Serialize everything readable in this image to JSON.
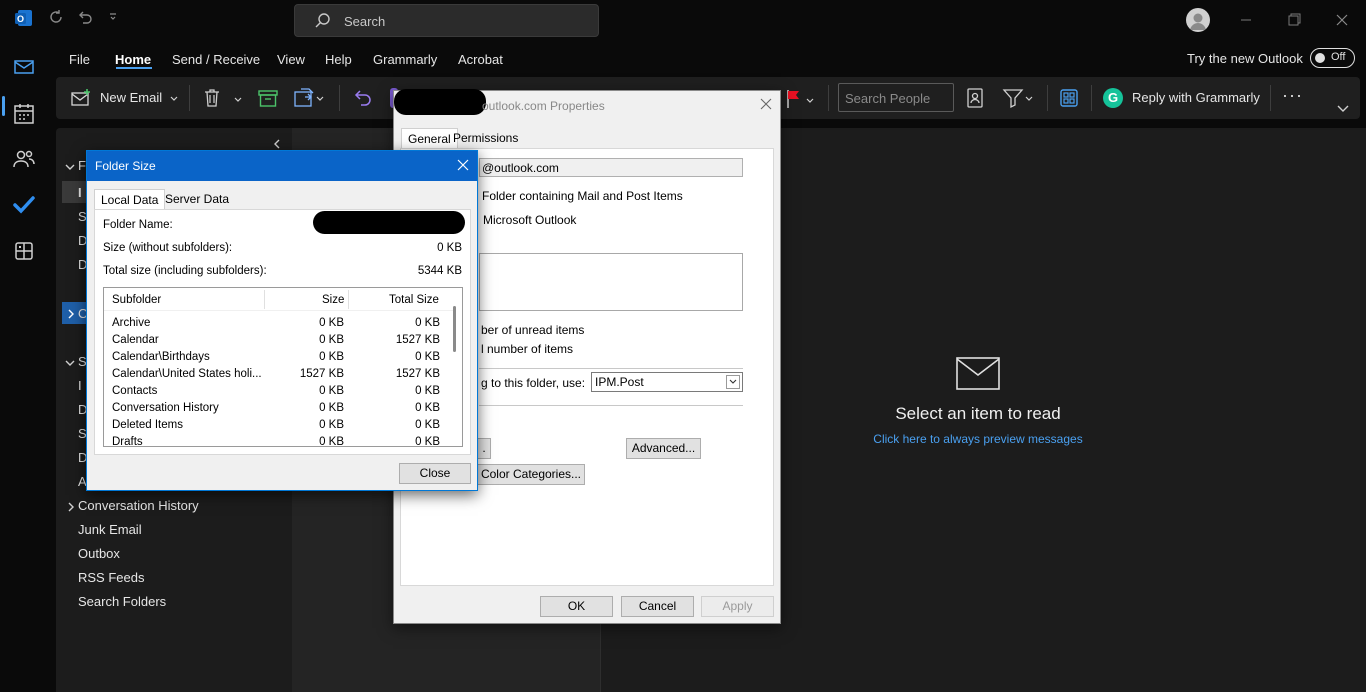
{
  "titlebar": {
    "search_placeholder": "Search"
  },
  "menubar": {
    "items": [
      "File",
      "Home",
      "Send / Receive",
      "View",
      "Help",
      "Grammarly",
      "Acrobat"
    ],
    "try_new_label": "Try the new Outlook",
    "toggle_label": "Off"
  },
  "ribbon": {
    "new_email_label": "New Email",
    "search_people_placeholder": "Search People",
    "reply_grammarly_label": "Reply with Grammarly",
    "more_label": "···"
  },
  "folder_pane": {
    "visible_letters": [
      "F",
      "I",
      "S",
      "D",
      "D",
      "O",
      "S",
      "I",
      "D",
      "S",
      "D",
      "A"
    ],
    "items": [
      "Conversation History",
      "Junk Email",
      "Outbox",
      "RSS Feeds",
      "Search Folders"
    ]
  },
  "reading_pane": {
    "title": "Select an item to read",
    "link": "Click here to always preview messages"
  },
  "props_dialog": {
    "title": "outlook.com Properties",
    "tabs": [
      "General",
      "Permissions"
    ],
    "account_field": "@outlook.com",
    "type_text": "Folder containing Mail and Post Items",
    "location_text": "Microsoft Outlook",
    "unread_text": "ber of unread items",
    "total_text": "l number of items",
    "post_label": "g to this folder, use:",
    "post_value": "IPM.Post",
    "partial_button": ".",
    "advanced_button": "Advanced...",
    "color_categories_button": "Color Categories...",
    "ok": "OK",
    "cancel": "Cancel",
    "apply": "Apply"
  },
  "folder_size_dialog": {
    "title": "Folder Size",
    "tabs": [
      "Local Data",
      "Server Data"
    ],
    "folder_name_label": "Folder Name:",
    "size_label": "Size (without subfolders):",
    "size_value": "0 KB",
    "total_label": "Total size (including subfolders):",
    "total_value": "5344 KB",
    "columns": [
      "Subfolder",
      "Size",
      "Total Size"
    ],
    "rows": [
      [
        "Archive",
        "0 KB",
        "0 KB"
      ],
      [
        "Calendar",
        "0 KB",
        "1527 KB"
      ],
      [
        "Calendar\\Birthdays",
        "0 KB",
        "0 KB"
      ],
      [
        "Calendar\\United States holi...",
        "1527 KB",
        "1527 KB"
      ],
      [
        "Contacts",
        "0 KB",
        "0 KB"
      ],
      [
        "Conversation History",
        "0 KB",
        "0 KB"
      ],
      [
        "Deleted Items",
        "0 KB",
        "0 KB"
      ],
      [
        "Drafts",
        "0 KB",
        "0 KB"
      ]
    ],
    "close": "Close"
  },
  "colors": {
    "accent": "#4aa0f0",
    "dialog_title": "#0a64c8",
    "flag": "#e81123",
    "grammarly": "#15c39a"
  }
}
